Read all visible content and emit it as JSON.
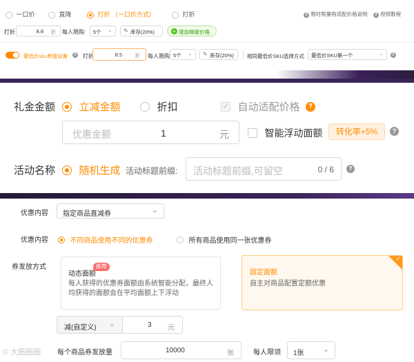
{
  "top": {
    "opt1": "一口价",
    "opt2": "直降",
    "opt3": "打折 （一口价方式）",
    "opt4": "打折",
    "help1": "限时限量购适配价格说明",
    "help2": "视频教程",
    "discount_label": "打折",
    "discount_value": "8.8",
    "discount_unit": "折",
    "limit_label": "每人限购:",
    "limit_value": "5个",
    "stock_btn": "库存(20%)",
    "add_ladder_btn": "增加梯度价格"
  },
  "row2": {
    "toggle_label": "最低价sku单独设置",
    "discount_label": "打折",
    "discount_value": "8.5",
    "discount_unit": "折",
    "limit_label": "每人限购",
    "limit_value": "5个",
    "stock_btn": "库存(20%)",
    "same_sku_label": "相同最低价SKU选择方式",
    "same_sku_value": "最低价SKU第一个"
  },
  "gift": {
    "label": "礼金金额",
    "opt_reduce": "立减金额",
    "opt_discount": "折扣",
    "auto_price": "自动适配价格",
    "amount_placeholder": "优惠金额",
    "amount_value": "1",
    "amount_unit": "元",
    "smart_float": "智能浮动面额",
    "conversion_badge": "转化率+5%"
  },
  "activity": {
    "label": "活动名称",
    "opt_random": "随机生成",
    "prefix_label": "活动标题前缀:",
    "prefix_placeholder": "活动标题前缀,可留空",
    "prefix_count": "0 / 6"
  },
  "coupon": {
    "content_label": "优惠内容",
    "content_select": "指定商品直减券",
    "content_label2": "优惠内容",
    "opt_diff": "不同商品使用不同的优惠券",
    "opt_same": "所有商品使用同一张优惠券",
    "issue_label": "券发放方式",
    "dynamic_title": "动态面额",
    "recommend_tag": "推荐",
    "dynamic_desc": "每人获得的优惠券面额由系统智能分配，最终人均获得的面额会在平均面额上下浮动",
    "fixed_title": "固定面额",
    "fixed_desc": "自主对商品配置定额优惠",
    "reduce_select": "减(自定义)",
    "reduce_value": "3",
    "reduce_unit": "元",
    "issue_qty_label": "每个商品券发放量",
    "issue_qty_value": "10000",
    "issue_qty_unit": "张",
    "per_limit_label": "每人限领",
    "per_limit_value": "1张",
    "watermark": "大圈圈圈"
  },
  "colors": {
    "accent": "#ff8c00",
    "green": "#52c41a",
    "band": "#2a1f3d"
  }
}
